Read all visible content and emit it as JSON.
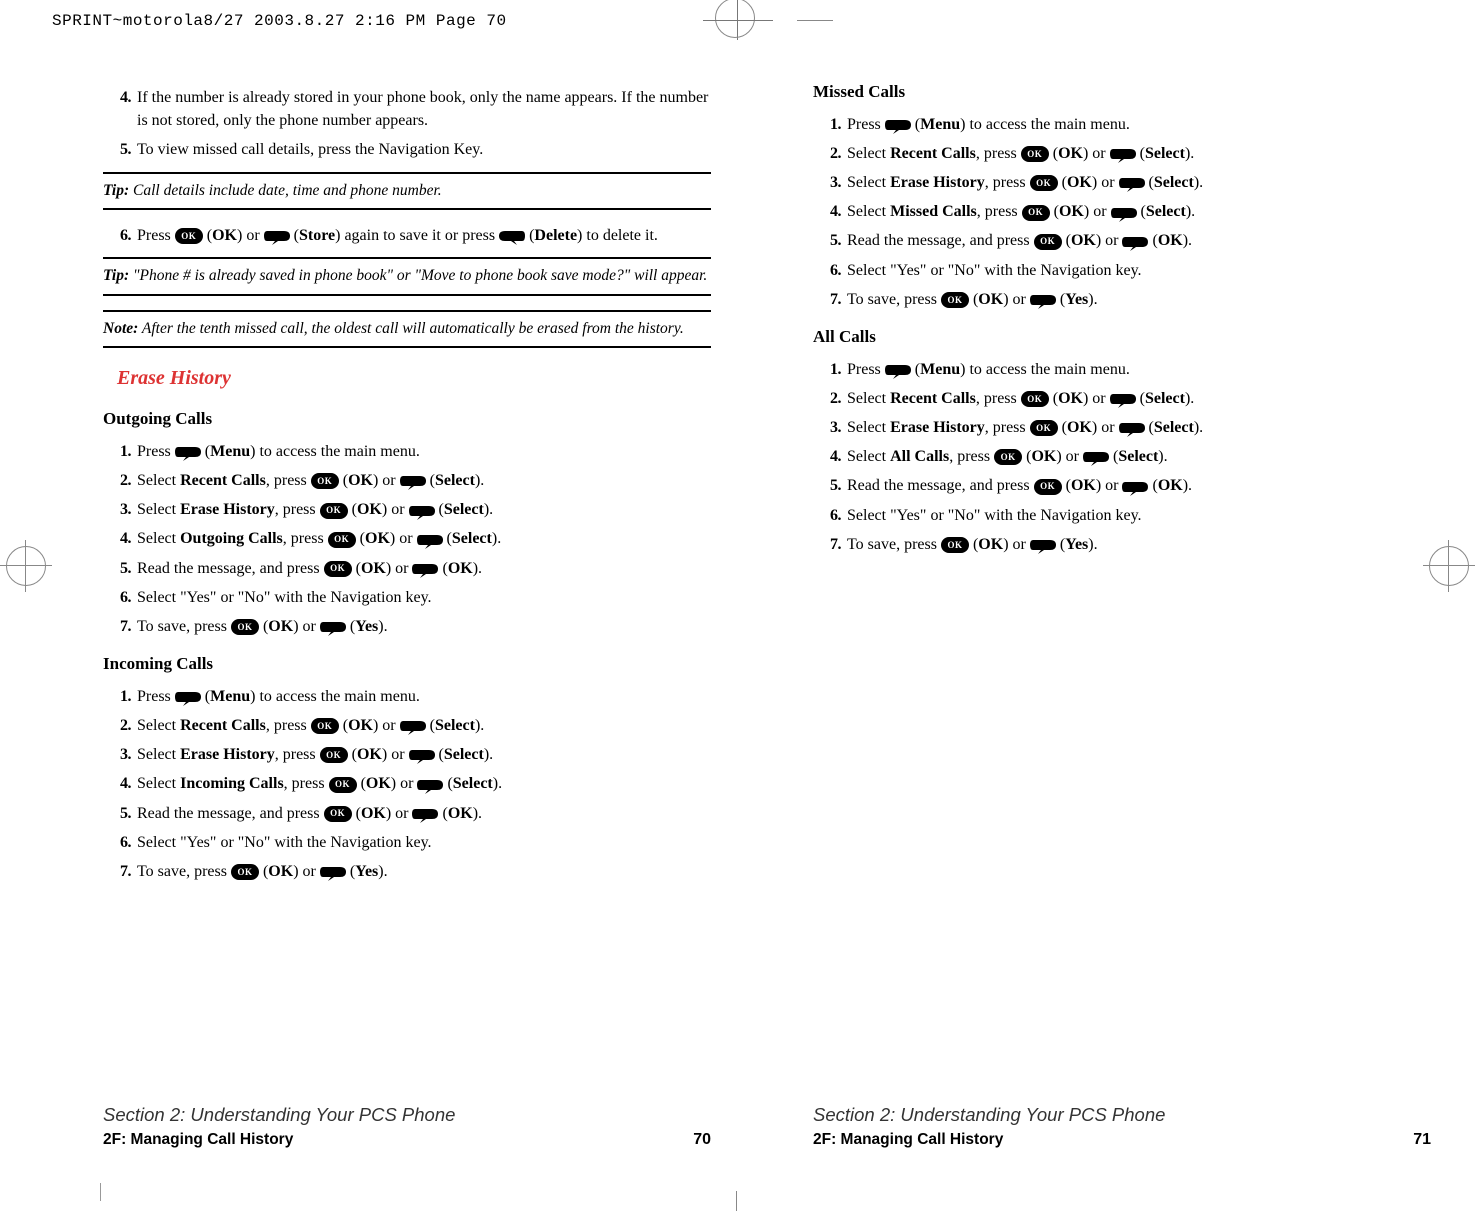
{
  "slug_header": "SPRINT~motorola8/27  2003.8.27  2:16 PM  Page 70",
  "icons": {
    "ok_label": "OK"
  },
  "left": {
    "cont_steps": [
      {
        "n": "4",
        "pre": "If the number is already stored in your phone book, only the name appears. If the number is not stored, only the phone number appears."
      },
      {
        "n": "5",
        "pre": "To view missed call details, press the Navigation Key."
      }
    ],
    "tip1_label": "Tip:",
    "tip1_text": " Call details include date, time and phone number.",
    "step6": {
      "n": "6",
      "pre": "Press ",
      "ok1_after": " (",
      "ok_bold": "OK",
      "ok1_close": ") or ",
      "store_after": " (",
      "store_bold": "Store",
      "store_close": ") again to save it or press ",
      "del_after": " (",
      "del_bold": "Delete",
      "del_close": ") to delete it."
    },
    "tip2_label": "Tip:",
    "tip2_text": " \"Phone # is already saved in phone book\" or \"Move to phone book save mode?\" will appear.",
    "note_label": "Note:",
    "note_text": " After the tenth missed call, the oldest call will automatically be erased from the history.",
    "erase_heading": "Erase History",
    "outgoing_head": "Outgoing Calls",
    "incoming_head": "Incoming Calls",
    "erase_section": {
      "outgoing_opt": "Outgoing Calls",
      "incoming_opt": "Incoming Calls"
    },
    "common_steps": {
      "s1_pre": "Press ",
      "s1_after": " (",
      "s1_bold": "Menu",
      "s1_close": ") to access the main menu.",
      "s2_pre": "Select ",
      "s2_bold": "Recent Calls",
      "s2_mid": ", press ",
      "s2_ok_open": " (",
      "s2_ok_bold": "OK",
      "s2_ok_close": ") or ",
      "s2_sel_open": " (",
      "s2_sel_bold": "Select",
      "s2_sel_close": ").",
      "s3_pre": "Select ",
      "s3_bold": "Erase History",
      "s3_mid": ", press ",
      "s4_pre": "Select ",
      "s4_mid": ", press ",
      "s5_pre": "Read the message, and press ",
      "s5_ok_open": " (",
      "s5_ok_bold": "OK",
      "s5_ok_close": ") or ",
      "s5_ok2_open": " (",
      "s5_ok2_bold": "OK",
      "s5_ok2_close": ").",
      "s6_text": "Select \"Yes\" or \"No\" with the Navigation key.",
      "s7_pre": "To save, press ",
      "s7_ok_open": " (",
      "s7_ok_bold": "OK",
      "s7_ok_close": ") or ",
      "s7_yes_open": " (",
      "s7_yes_bold": "Yes",
      "s7_yes_close": ")."
    },
    "footer_line1": "Section 2: Understanding Your PCS Phone",
    "footer_line2": "2F: Managing Call History",
    "page_number": "70"
  },
  "right": {
    "missed_head": "Missed Calls",
    "all_head": "All Calls",
    "missed_opt": "Missed Calls",
    "all_opt": "All Calls",
    "footer_line1": "Section 2: Understanding Your PCS Phone",
    "footer_line2": "2F: Managing Call History",
    "page_number": "71"
  }
}
